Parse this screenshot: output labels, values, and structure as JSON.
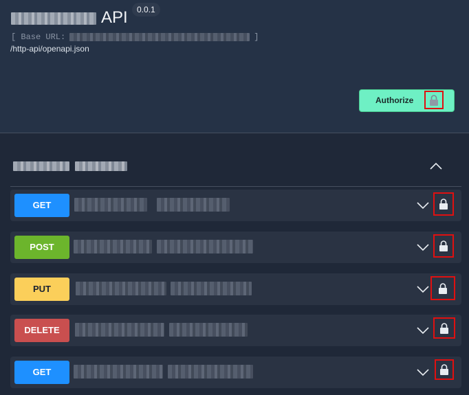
{
  "info": {
    "title_suffix": "API",
    "version": "0.0.1",
    "base_url_open": "[ Base URL:",
    "base_url_close": "]",
    "spec_link": "/http-api/openapi.json"
  },
  "authorize": {
    "label": "Authorize",
    "icon": "lock-icon"
  },
  "tag": {
    "expanded": true
  },
  "colors": {
    "get": "#1e90ff",
    "post": "#6cb52c",
    "put": "#fbcf5a",
    "delete": "#c94f4f",
    "authorize_bg": "#6ef0c4",
    "highlight": "#e01010"
  },
  "operations": [
    {
      "method": "GET"
    },
    {
      "method": "POST"
    },
    {
      "method": "PUT"
    },
    {
      "method": "DELETE"
    },
    {
      "method": "GET"
    }
  ]
}
